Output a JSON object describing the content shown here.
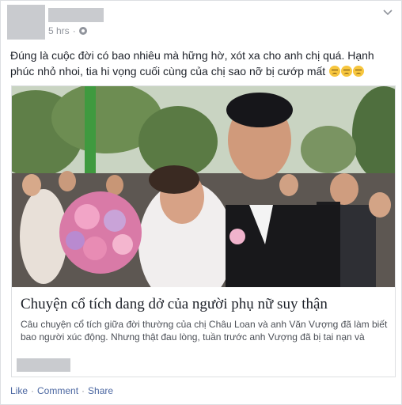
{
  "post": {
    "time": "5 hrs",
    "audience_icon": "globe-icon",
    "menu_icon": "chevron-down-icon",
    "text": "Đúng là cuộc đời có bao nhiêu mà hững hờ, xót xa cho anh chị quá. Hạnh phúc nhỏ nhoi, tia hi vọng cuối cùng của chị sao nỡ bị cướp mất",
    "emojis": [
      "sad-face",
      "sad-face",
      "sad-face"
    ]
  },
  "link": {
    "image_description_icon": "wedding-photo",
    "title": "Chuyện cổ tích dang dở của người phụ nữ suy thận",
    "description": "Câu chuyện cổ tích giữa đời thường của chị Châu Loan và anh Văn Vượng đã làm biết bao người xúc động. Nhưng thật đau lòng, tuần trước anh Vượng đã bị tai nạn và"
  },
  "actions": {
    "like": "Like",
    "comment": "Comment",
    "share": "Share",
    "separator": "·"
  },
  "colors": {
    "link_blue": "#4b67a1",
    "meta_gray": "#90949c",
    "redacted_gray": "#c9cbcf"
  }
}
